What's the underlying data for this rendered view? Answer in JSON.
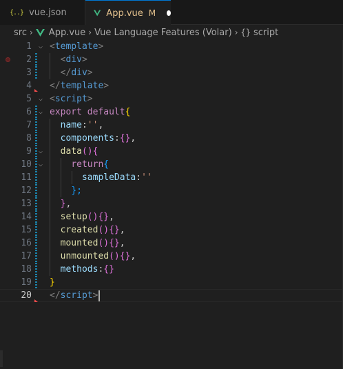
{
  "tabs": [
    {
      "icon": "{..}",
      "label": "vue.json",
      "active": false
    },
    {
      "label": "App.vue",
      "modified": "M",
      "active": true
    }
  ],
  "breadcrumb": {
    "folder": "src",
    "file": "App.vue",
    "section": "Vue Language Features (Volar)",
    "symbol": "script",
    "symbol_icon": "{}"
  },
  "colors": {
    "accent": "#0078d4",
    "vue_green": "#41b883",
    "modified": "#e2c08d"
  },
  "line_numbers": [
    "1",
    "2",
    "3",
    "4",
    "5",
    "6",
    "7",
    "8",
    "9",
    "10",
    "11",
    "12",
    "13",
    "14",
    "15",
    "16",
    "17",
    "18",
    "19",
    "20"
  ],
  "code": {
    "l1": [
      "<",
      "template",
      ">"
    ],
    "l2": [
      "<",
      "div",
      ">"
    ],
    "l3": [
      "</",
      "div",
      ">"
    ],
    "l4": [
      "</",
      "template",
      ">"
    ],
    "l5": [
      "<",
      "script",
      ">"
    ],
    "l6": [
      "export",
      " ",
      "default",
      "{"
    ],
    "l7": [
      "name",
      ":",
      "''",
      ","
    ],
    "l8": [
      "components",
      ":",
      "{}",
      ","
    ],
    "l9": [
      "data",
      "()",
      "{"
    ],
    "l10": [
      "return",
      "{"
    ],
    "l11": [
      "sampleData",
      ":",
      "''"
    ],
    "l12": [
      "};"
    ],
    "l13": [
      "}",
      ","
    ],
    "l14": [
      "setup",
      "()",
      "{}",
      ","
    ],
    "l15": [
      "created",
      "()",
      "{}",
      ","
    ],
    "l16": [
      "mounted",
      "()",
      "{}",
      ","
    ],
    "l17": [
      "unmounted",
      "()",
      "{}",
      ","
    ],
    "l18": [
      "methods",
      ":",
      "{}"
    ],
    "l19": [
      "}"
    ],
    "l20": [
      "</",
      "script",
      ">"
    ]
  }
}
